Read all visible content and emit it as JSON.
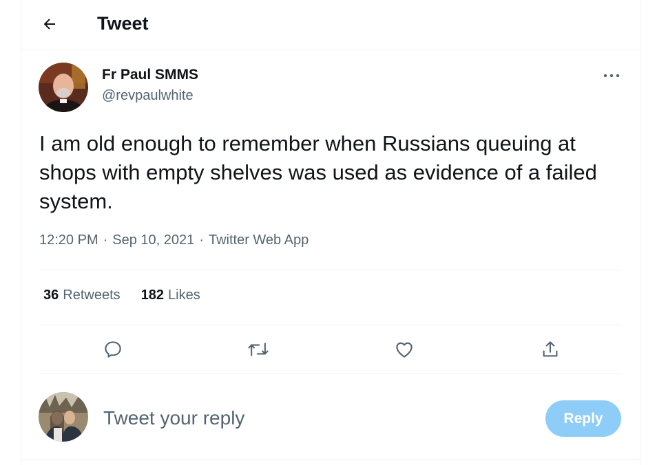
{
  "header": {
    "title": "Tweet",
    "back_icon": "arrow-left-icon"
  },
  "tweet": {
    "author": {
      "name": "Fr Paul SMMS",
      "handle": "@revpaulwhite"
    },
    "text": "I am old enough to remember when Russians queuing at shops with empty shelves was used as evidence of a failed system.",
    "time": "12:20 PM",
    "date": "Sep 10, 2021",
    "source": "Twitter Web App",
    "separator": "·",
    "retweets_count": "36",
    "retweets_label": "Retweets",
    "likes_count": "182",
    "likes_label": "Likes"
  },
  "actions": [
    "reply-icon",
    "retweet-icon",
    "like-icon",
    "share-icon"
  ],
  "reply_box": {
    "placeholder": "Tweet your reply",
    "button_label": "Reply"
  },
  "colors": {
    "text": "#0f1419",
    "muted": "#536471",
    "divider": "#eff3f4",
    "reply_button_disabled": "#8ecdf8"
  }
}
